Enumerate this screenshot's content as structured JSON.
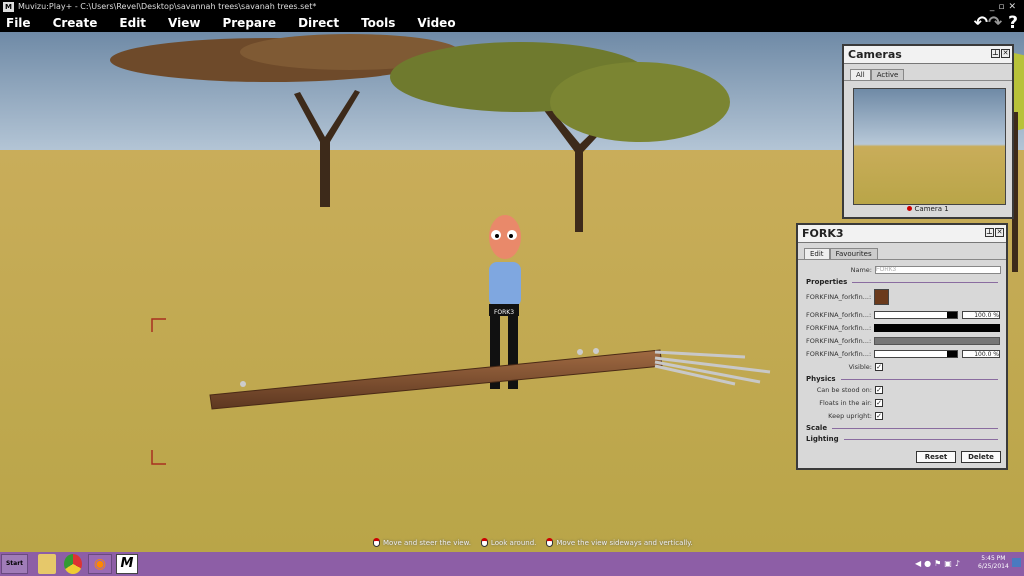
{
  "window": {
    "title": "Muvizu:Play+ - C:\\Users\\Revel\\Desktop\\savannah trees\\savanah trees.set*",
    "app_icon": "M"
  },
  "menu": [
    "File",
    "Create",
    "Edit",
    "View",
    "Prepare",
    "Direct",
    "Tools",
    "Video"
  ],
  "top_icons": {
    "undo": "undo-icon",
    "redo": "redo-icon",
    "help": "?"
  },
  "scene": {
    "character_shirt_label": "FORK3"
  },
  "cameras_panel": {
    "title": "Cameras",
    "tabs": [
      "All",
      "Active"
    ],
    "active_tab": "All",
    "camera_label": "Camera 1",
    "camera_status_color": "#cc0000"
  },
  "fork_panel": {
    "title": "FORK3",
    "tabs": [
      "Edit",
      "Favourites"
    ],
    "active_tab": "Edit",
    "name_label": "Name:",
    "name_value": "FORK3",
    "properties_header": "Properties",
    "properties": [
      {
        "label": "FORKFINA_forkfin...:",
        "type": "texture"
      },
      {
        "label": "FORKFINA_forkfin...:",
        "type": "color",
        "color": "#000000",
        "value": "100.0 %"
      },
      {
        "label": "FORKFINA_forkfin...:",
        "type": "color",
        "color": "#000000"
      },
      {
        "label": "FORKFINA_forkfin...:",
        "type": "color",
        "color": "#777777"
      },
      {
        "label": "FORKFINA_forkfin...:",
        "type": "color",
        "color": "#000000",
        "value": "100.0 %"
      }
    ],
    "visible_label": "Visible:",
    "physics_header": "Physics",
    "physics": [
      {
        "label": "Can be stood on:",
        "checked": true
      },
      {
        "label": "Floats in the air:",
        "checked": true
      },
      {
        "label": "Keep upright:",
        "checked": true
      }
    ],
    "scale_header": "Scale",
    "lighting_header": "Lighting",
    "reset_label": "Reset",
    "delete_label": "Delete"
  },
  "hints": [
    "Move and steer the view.",
    "Look around.",
    "Move the view sideways and vertically."
  ],
  "taskbar": {
    "start_label": "Start",
    "clock_time": "5:45 PM",
    "clock_date": "6/25/2014"
  }
}
